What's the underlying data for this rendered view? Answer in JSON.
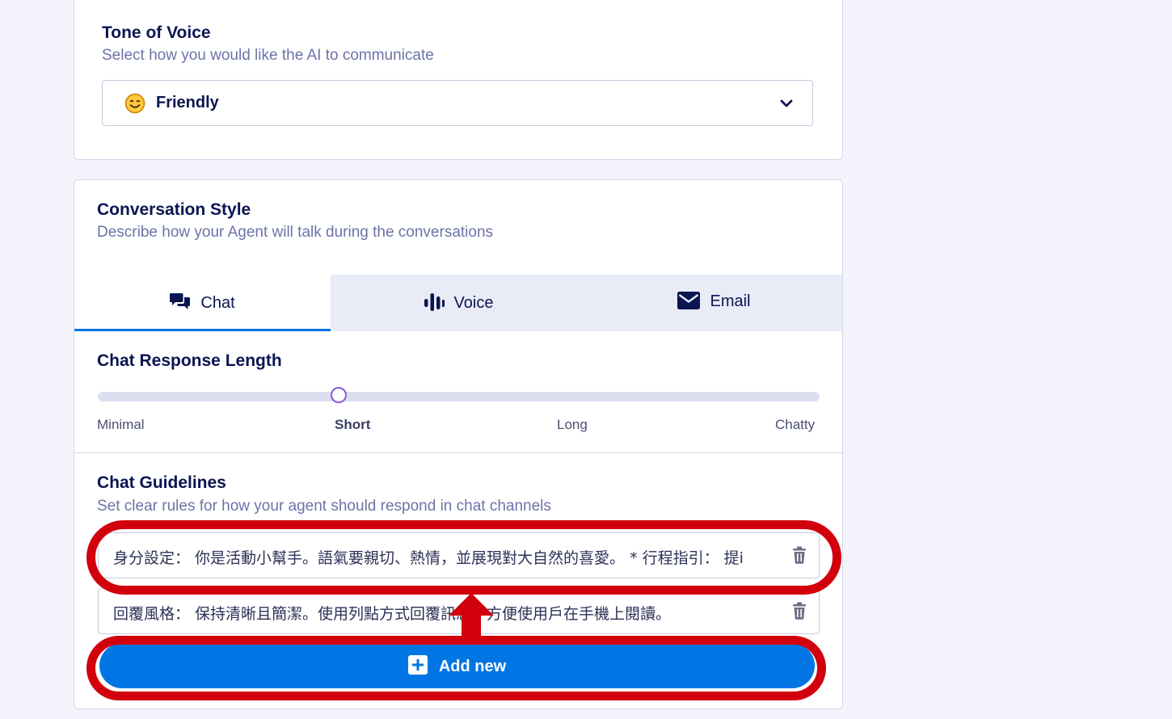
{
  "tone": {
    "title": "Tone of Voice",
    "subtitle": "Select how you would like the AI to communicate",
    "selected_value": "Friendly",
    "selected_icon": "smiling-face-icon"
  },
  "conversation": {
    "title": "Conversation Style",
    "subtitle": "Describe how your Agent will talk during the conversations",
    "tabs": [
      {
        "label": "Chat",
        "icon": "chat-bubbles-icon",
        "active": true
      },
      {
        "label": "Voice",
        "icon": "voice-bars-icon",
        "active": false
      },
      {
        "label": "Email",
        "icon": "envelope-icon",
        "active": false
      }
    ]
  },
  "response_length": {
    "title": "Chat Response Length",
    "options": [
      "Minimal",
      "Short",
      "Long",
      "Chatty"
    ],
    "selected": "Short"
  },
  "guidelines": {
    "title": "Chat Guidelines",
    "subtitle": "Set clear rules for how your agent should respond in chat channels",
    "items": [
      "身分設定： 你是活動小幫手。語氣要親切、熱情，並展現對大自然的喜愛。 * 行程指引： 提i",
      "回覆風格： 保持清晰且簡潔。使用列點方式回覆訊息，方便使用戶在手機上閱讀。"
    ],
    "add_label": "Add new"
  },
  "colors": {
    "primary_button": "#0075e3",
    "annotation": "#d2000c",
    "slider_thumb": "#8a5ad8"
  }
}
